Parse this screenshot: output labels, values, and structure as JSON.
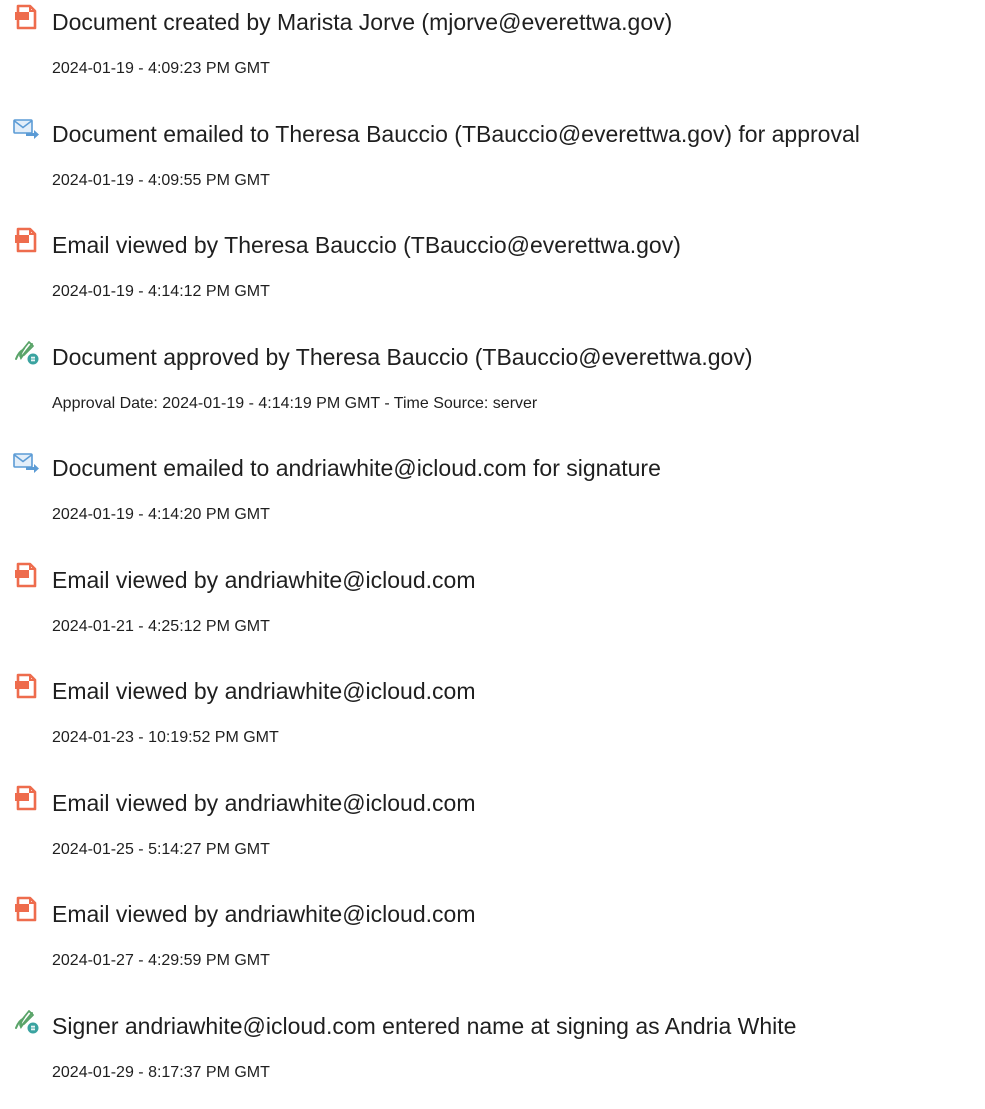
{
  "colors": {
    "document_icon": "#ee6c4d",
    "email_icon": "#5b9bd5",
    "approve_pen": "#5aa469",
    "approve_badge": "#3aa3a0"
  },
  "events": [
    {
      "icon": "document-icon",
      "title": "Document created by Marista Jorve (mjorve@everettwa.gov)",
      "detail": "2024-01-19 - 4:09:23 PM GMT"
    },
    {
      "icon": "email-sent-icon",
      "title": "Document emailed to Theresa Bauccio (TBauccio@everettwa.gov) for approval",
      "detail": "2024-01-19 - 4:09:55 PM GMT"
    },
    {
      "icon": "document-icon",
      "title": "Email viewed by Theresa Bauccio (TBauccio@everettwa.gov)",
      "detail": "2024-01-19 - 4:14:12 PM GMT"
    },
    {
      "icon": "approve-signature-icon",
      "title": "Document approved by Theresa Bauccio (TBauccio@everettwa.gov)",
      "detail": "Approval Date: 2024-01-19 - 4:14:19 PM GMT - Time Source: server"
    },
    {
      "icon": "email-sent-icon",
      "title": "Document emailed to andriawhite@icloud.com for signature",
      "detail": "2024-01-19 - 4:14:20 PM GMT"
    },
    {
      "icon": "document-icon",
      "title": "Email viewed by andriawhite@icloud.com",
      "detail": "2024-01-21 - 4:25:12 PM GMT"
    },
    {
      "icon": "document-icon",
      "title": "Email viewed by andriawhite@icloud.com",
      "detail": "2024-01-23 - 10:19:52 PM GMT"
    },
    {
      "icon": "document-icon",
      "title": "Email viewed by andriawhite@icloud.com",
      "detail": "2024-01-25 - 5:14:27 PM GMT"
    },
    {
      "icon": "document-icon",
      "title": "Email viewed by andriawhite@icloud.com",
      "detail": "2024-01-27 - 4:29:59 PM GMT"
    },
    {
      "icon": "approve-signature-icon",
      "title": "Signer andriawhite@icloud.com entered name at signing as Andria White",
      "detail": "2024-01-29 - 8:17:37 PM GMT"
    }
  ]
}
